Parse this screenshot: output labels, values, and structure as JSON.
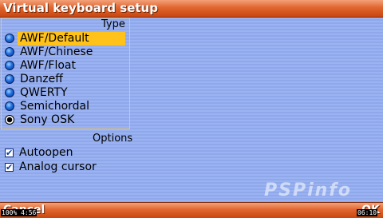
{
  "title": "Virtual keyboard setup",
  "type_section": {
    "title": "Type",
    "options": [
      {
        "label": "AWF/Default",
        "highlighted": true,
        "selected": false
      },
      {
        "label": "AWF/Chinese",
        "highlighted": false,
        "selected": false
      },
      {
        "label": "AWF/Float",
        "highlighted": false,
        "selected": false
      },
      {
        "label": "Danzeff",
        "highlighted": false,
        "selected": false
      },
      {
        "label": "QWERTY",
        "highlighted": false,
        "selected": false
      },
      {
        "label": "Semichordal",
        "highlighted": false,
        "selected": false
      },
      {
        "label": "Sony OSK",
        "highlighted": false,
        "selected": true
      }
    ]
  },
  "options_section": {
    "title": "Options",
    "checkboxes": [
      {
        "label": "Autoopen",
        "checked": true
      },
      {
        "label": "Analog cursor",
        "checked": true
      }
    ]
  },
  "bottom_bar": {
    "cancel_label": "Cancel",
    "ok_label": "OK"
  },
  "status": {
    "left": "100% 4:56",
    "right": "06:10"
  },
  "watermark": "PSPinfo",
  "colors": {
    "title_bar": "#e0662f",
    "background": "#95aef0",
    "highlight": "#ffc21a"
  }
}
